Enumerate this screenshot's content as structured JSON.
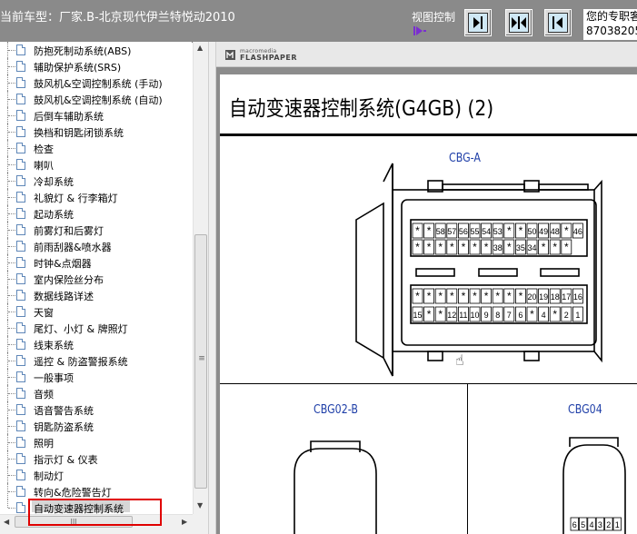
{
  "header": {
    "car_title": "当前车型：厂家.B-北京现代伊兰特悦动2010",
    "view_control_label": "视图控制",
    "ad_line1": "您的专职客",
    "ad_line2": "87038205"
  },
  "tree": {
    "items": [
      "防抱死制动系统(ABS)",
      "辅助保护系统(SRS)",
      "鼓风机&空调控制系统 (手动)",
      "鼓风机&空调控制系统 (自动)",
      "后倒车辅助系统",
      "换档和钥匙闭锁系统",
      "检查",
      "喇叭",
      "冷却系统",
      "礼貌灯 & 行李箱灯",
      "起动系统",
      "前雾灯和后雾灯",
      "前雨刮器&喷水器",
      "时钟&点烟器",
      "室内保险丝分布",
      "数据线路详述",
      "天窗",
      "尾灯、小灯 & 牌照灯",
      "线束系统",
      "遥控 & 防盗警报系统",
      "一般事项",
      "音频",
      "语音警告系统",
      "钥匙防盗系统",
      "照明",
      "指示灯 & 仪表",
      "制动灯",
      "转向&危险警告灯",
      "自动变速器控制系统"
    ],
    "selected_index": 28,
    "hscroll_grip": "III"
  },
  "viewer": {
    "logo_small": "macromedia",
    "logo_big": "FLASHPAPER",
    "page_title": "自动变速器控制系统(G4GB) (2)",
    "connector_a_label": "CBG-A",
    "connector_b_label": "CBG02-B",
    "connector_c_label": "CBG04",
    "cbg_a_row1": [
      "*",
      "*",
      "58",
      "57",
      "56",
      "55",
      "54",
      "53",
      "*",
      "*",
      "50",
      "49",
      "48",
      "*",
      "46"
    ],
    "cbg_a_row2": [
      "*",
      "*",
      "*",
      "*",
      "*",
      "*",
      "*",
      "38",
      "*",
      "35",
      "34",
      "*",
      "*",
      "*"
    ],
    "cbg_a_row3": [
      "*",
      "*",
      "*",
      "*",
      "*",
      "*",
      "*",
      "*",
      "*",
      "*",
      "20",
      "19",
      "18",
      "17",
      "16"
    ],
    "cbg_a_row4": [
      "15",
      "*",
      "*",
      "12",
      "11",
      "10",
      "9",
      "8",
      "7",
      "6",
      "*",
      "4",
      "*",
      "2",
      "1"
    ],
    "cbg04_pins": [
      "6",
      "5",
      "4",
      "3",
      "2",
      "1"
    ]
  },
  "colors": {
    "header_bg": "#8a8a8a",
    "label_blue": "#1f3fa8",
    "highlight_red": "#e00000",
    "button_face": "#cfe8f5"
  }
}
